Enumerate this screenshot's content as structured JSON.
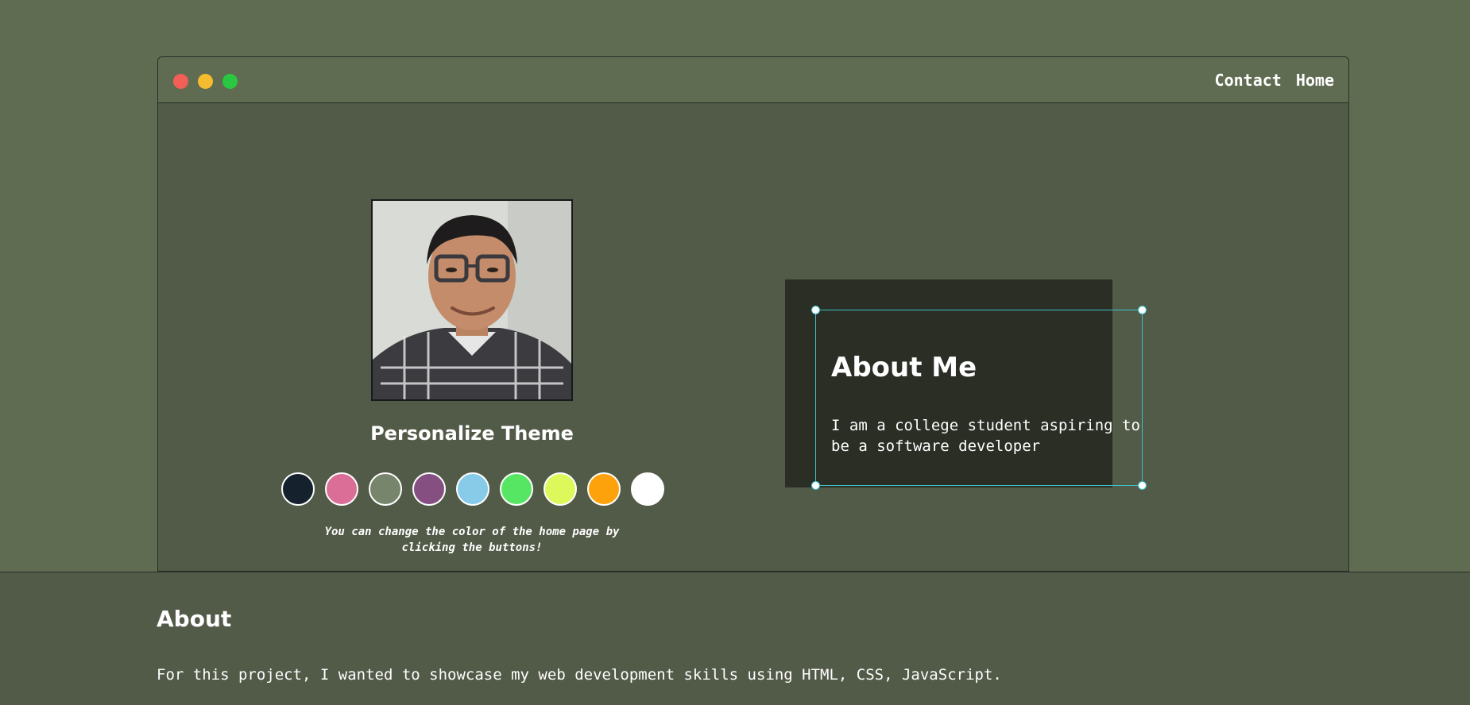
{
  "nav": {
    "contact_label": "Contact",
    "home_label": "Home"
  },
  "theme": {
    "title": "Personalize Theme",
    "hint": "You can change the color of the home page by clicking the buttons!",
    "swatches": [
      "#15222e",
      "#da6e96",
      "#76856b",
      "#864f82",
      "#87cbe8",
      "#57e663",
      "#dcf85a",
      "#fda20a",
      "#ffffff"
    ]
  },
  "about_card": {
    "title": "About Me",
    "text": "I am a college student aspiring to be a software developer"
  },
  "footer": {
    "title": "About",
    "text": "For this project, I wanted to showcase my web development skills using HTML, CSS, JavaScript."
  },
  "colors": {
    "page_bg": "#5f6c52",
    "content_bg": "#525a48",
    "card_bg": "#2a2e25",
    "selection": "#3fc1c9"
  }
}
